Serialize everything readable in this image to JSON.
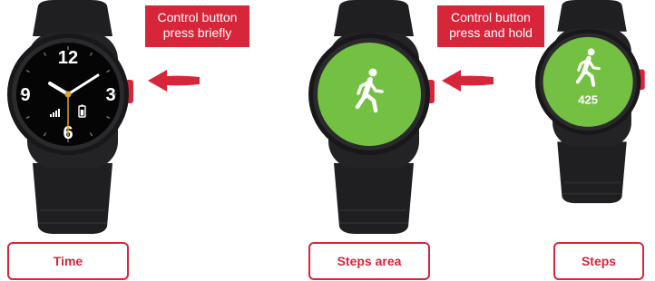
{
  "watch_time": {
    "dial_numbers": [
      "12",
      "3",
      "6",
      "9"
    ]
  },
  "callout_brief": {
    "line1": "Control button",
    "line2": "press briefly"
  },
  "callout_hold": {
    "line1": "Control button",
    "line2": "press and hold"
  },
  "watch_steps": {
    "step_count": "425"
  },
  "labels": {
    "time": "Time",
    "steps_area": "Steps area",
    "steps": "Steps"
  },
  "colors": {
    "accent": "#d7253a",
    "screen_green": "#74c043",
    "watch_body": "#1d1d1f"
  }
}
